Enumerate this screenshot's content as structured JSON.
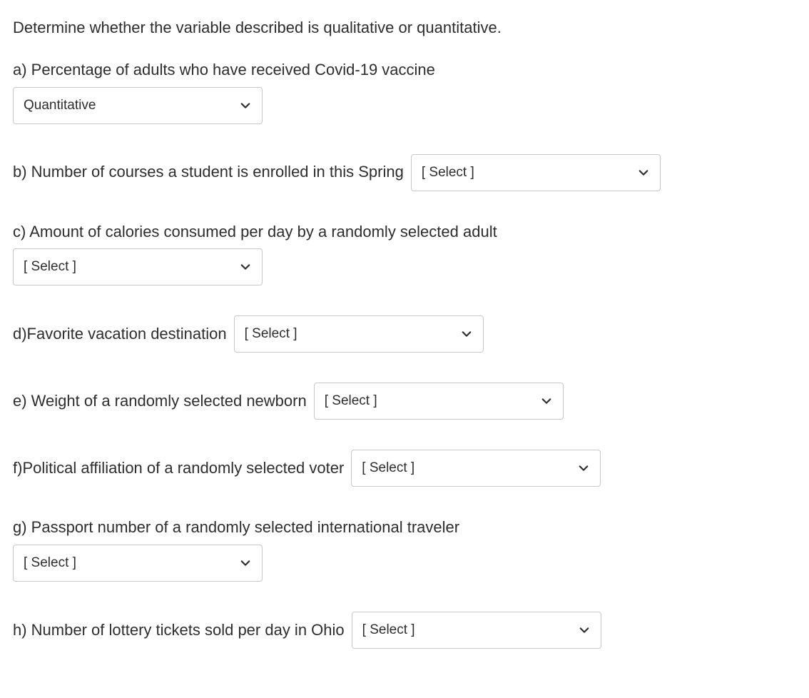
{
  "prompt": "Determine whether the variable described is qualitative or quantitative.",
  "questions": {
    "a": {
      "text": "a) Percentage of adults who have received Covid-19 vaccine",
      "value": "Quantitative"
    },
    "b": {
      "text": "b) Number of courses a student is enrolled in this Spring",
      "value": "[ Select ]"
    },
    "c": {
      "text": "c) Amount of calories consumed per day by a randomly selected adult",
      "value": "[ Select ]"
    },
    "d": {
      "text": "d)Favorite vacation destination",
      "value": "[ Select ]"
    },
    "e": {
      "text": "e) Weight of a randomly selected newborn",
      "value": "[ Select ]"
    },
    "f": {
      "text": "f)Political affiliation of a randomly selected voter",
      "value": "[ Select ]"
    },
    "g": {
      "text": "g) Passport number of a randomly selected international traveler",
      "value": "[ Select ]"
    },
    "h": {
      "text": "h) Number of lottery tickets sold per day in Ohio",
      "value": "[ Select ]"
    }
  }
}
